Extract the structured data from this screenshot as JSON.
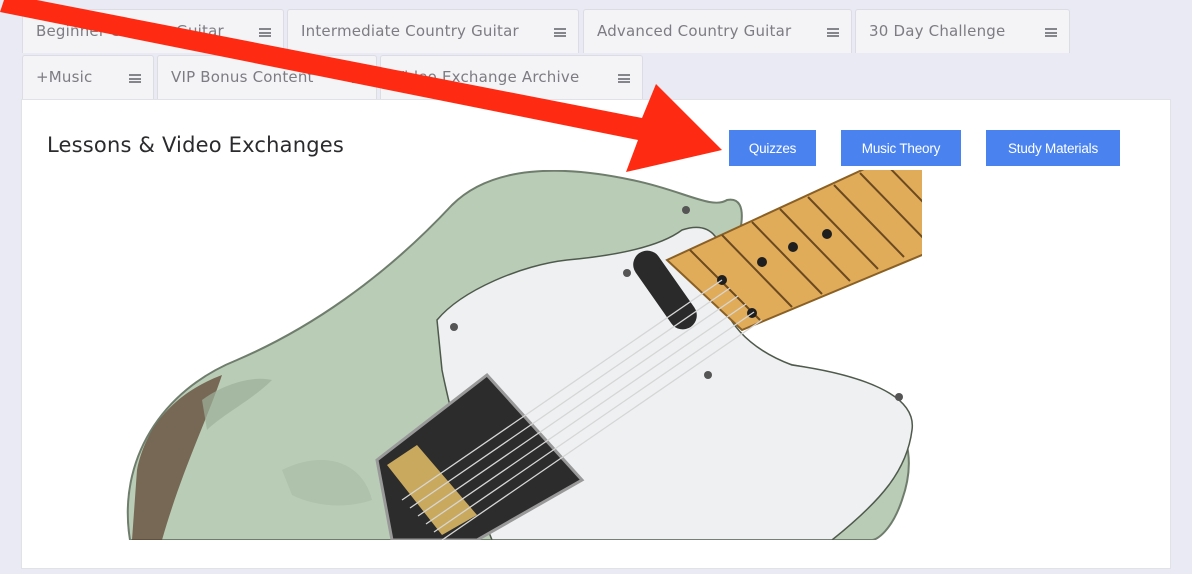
{
  "tabs": [
    {
      "label": "Beginner Country Guitar"
    },
    {
      "label": "Intermediate Country Guitar"
    },
    {
      "label": "Advanced Country Guitar"
    },
    {
      "label": "30 Day Challenge"
    },
    {
      "label": "+Music"
    },
    {
      "label": "VIP Bonus Content"
    },
    {
      "label": "Video Exchange Archive"
    }
  ],
  "page": {
    "title": "Lessons & Video Exchanges"
  },
  "buttons": {
    "quizzes": "Quizzes",
    "music_theory": "Music Theory",
    "study_materials": "Study Materials"
  },
  "colors": {
    "button": "#4a83f0",
    "annotation_arrow": "#ff2a12",
    "background": "#e9eaf3"
  },
  "icons": [
    "menu-icon",
    "arrow-annotation",
    "guitar-image"
  ]
}
